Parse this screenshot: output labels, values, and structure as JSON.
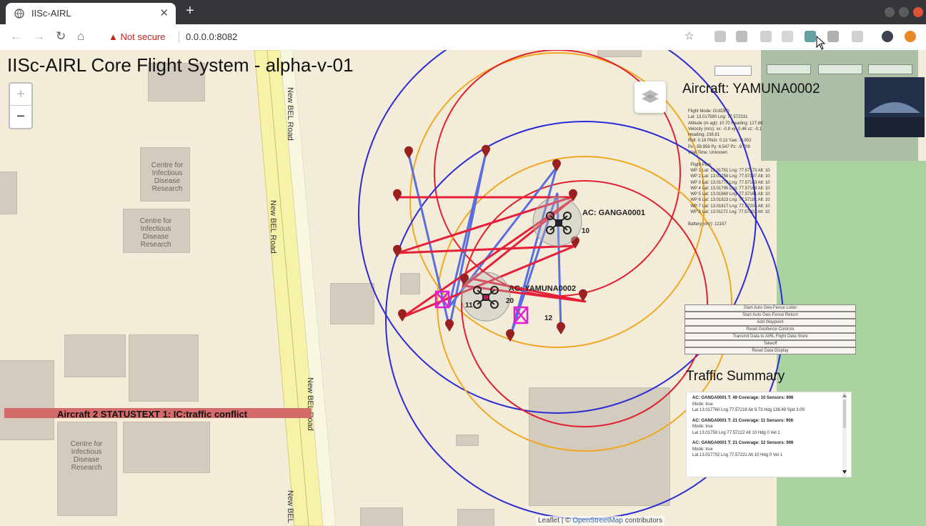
{
  "browser": {
    "tab_title": "IISc-AIRL",
    "security_label": "Not secure",
    "url": "0.0.0.0:8082"
  },
  "app": {
    "title": "IISc-AIRL Core Flight System - alpha-v-01"
  },
  "map": {
    "zoom_in": "+",
    "zoom_out": "−",
    "road_labels": [
      "New BEL Road",
      "New BEL Road",
      "New BEL Road",
      "New BEL"
    ],
    "building_labels": [
      "Centre for Infectious Disease Research",
      "Centre for Infectious Disease Research",
      "Centre for Infectious Disease Research"
    ],
    "attribution_prefix": "Leaflet | © ",
    "attribution_link": "OpenStreetMap",
    "attribution_suffix": " contributors"
  },
  "aircraft": [
    {
      "label": "AC: GANGA0001",
      "id_number": "10"
    },
    {
      "label": "AC: YAMUNA0002",
      "id_number": "20"
    }
  ],
  "waypoint_numbers": [
    "11",
    "12"
  ],
  "alert": {
    "text": "Aircraft 2 STATUSTEXT 1: IC:traffic conflict"
  },
  "panel": {
    "header": "Aircraft: YAMUNA0002",
    "details": "Flight Mode: GUIDED\nLat: 13.017580 Lng: 77.572331\nAltitude (m agl): 10.70 Heading: 127.88\nVelocity (m/s): vx: -0.8 vy: 0.46 vz: -0.1\nHeading: 238.81\nRoll: 0.16 Pitch: 0.13 Yaw: -0.902\nPx: -59.958 Py: 6.547 Pz: -9.709\nWait Time: Unknown\n\n  Flight Plan\n  WP 1 Lat: 13.01751 Lng: 77.57173 Alt: 10\n  WP 2 Lat: 13.01758 Lng: 77.57197 Alt: 10\n  WP 3 Lat: 13.01779 Lng: 77.57183 Alt: 10\n  WP 4 Lat: 13.01795 Lng: 77.57169 Alt: 10\n  WP 5 Lat: 13.01860 Lng: 77.57161 Alt: 10\n  WP 6 Lat: 13.01823 Lng: 77.57181 Alt: 10\n  WP 7 Lat: 13.01817 Lng: 77.57204 Alt: 10\n  WP 8 Lat: 13.01172 Lng: 77.57202 Alt: 10\n\nBattery (mV): 12157",
    "buttons": [
      "Start Auto Geo-Fence Loiter",
      "Start Auto Geo-Fence Return",
      "Add Waypoint",
      "Reset Geofence Controls",
      "Transmit Data to AIRL Flight Data Store",
      "Takeoff",
      "Reset Data Display"
    ]
  },
  "traffic": {
    "header": "Traffic Summary",
    "entries": [
      {
        "title": "AC: GANGA0001 T: 49 Coverage: 10 Sensors: 906",
        "line2": "Mode: true",
        "line3": "Lat 13.017760 Lng 77.57218 Alt 9.73 Hdg 138.49 Spd 3.09"
      },
      {
        "title": "AC: GANGA0001 T: 21 Coverage: 11 Sensors: 906",
        "line2": "Mode: true",
        "line3": "Lat 13.01758 Lng 77.57222 Alt 10 Hdg 0 Vel 1"
      },
      {
        "title": "AC: GANGA0001 T: 21 Coverage: 12 Sensors: 906",
        "line2": "Mode: true",
        "line3": "Lat 13.017702 Lng 77.57221 Alt 10 Hdg 0 Vel 1"
      }
    ]
  },
  "colors": {
    "geofence_blue": "#2b2bd6",
    "geofence_red": "#e0202e",
    "geofence_orange": "#f0a820",
    "route_red": "#e6203a",
    "route_blue": "#5a6ee0",
    "waypoint_marker": "#9a2020",
    "alert_bg": "#d56a6a"
  }
}
